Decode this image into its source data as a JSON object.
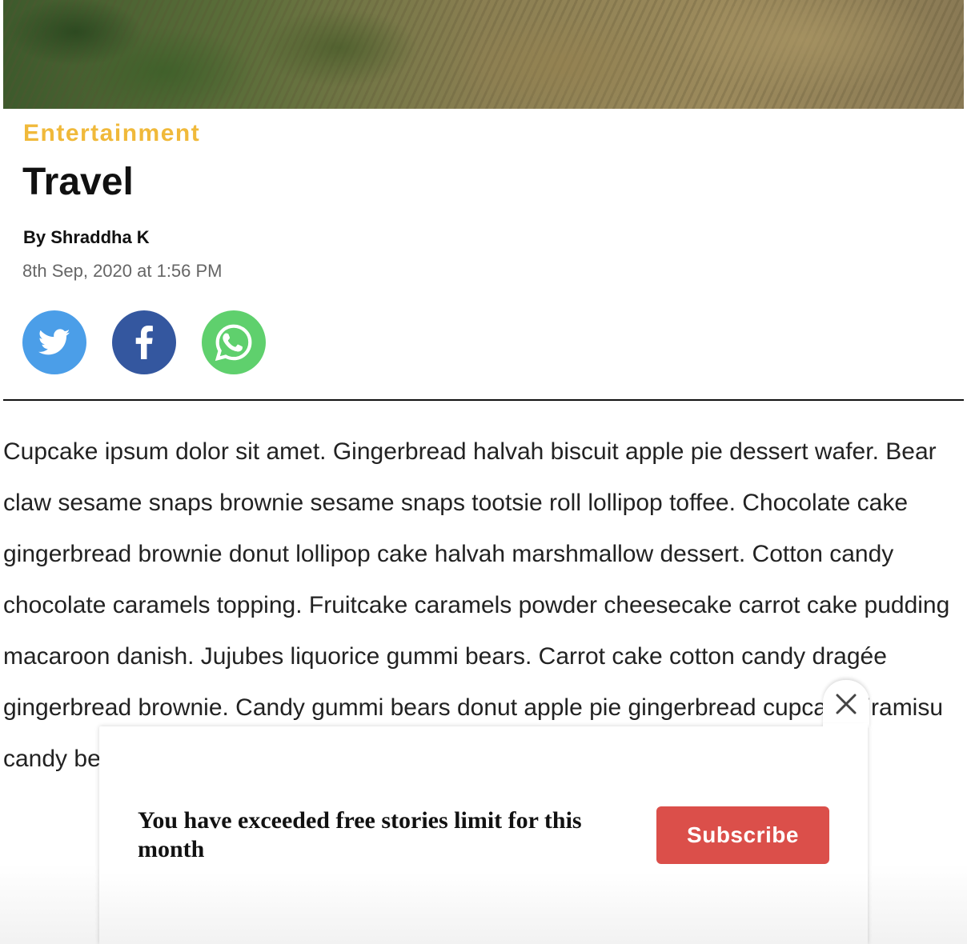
{
  "article": {
    "category": "Entertainment",
    "title": "Travel",
    "byline": "By Shraddha K",
    "date": "8th Sep, 2020 at 1:56 PM",
    "body": "Cupcake ipsum dolor sit amet. Gingerbread halvah biscuit apple pie dessert wafer. Bear claw sesame snaps brownie sesame snaps tootsie roll lollipop toffee. Chocolate cake gingerbread brownie donut lollipop cake halvah marshmallow dessert. Cotton candy chocolate caramels topping. Fruitcake caramels powder cheesecake carrot cake pudding macaroon danish. Jujubes liquorice gummi bears. Carrot cake cotton candy dragée gingerbread brownie. Candy gummi bears donut apple pie gingerbread cupcake tiramisu candy bear claw"
  },
  "share": {
    "buttons": [
      {
        "network": "twitter",
        "icon": "twitter-icon",
        "color": "#4b9ee8"
      },
      {
        "network": "facebook",
        "icon": "facebook-icon",
        "color": "#34579f"
      },
      {
        "network": "whatsapp",
        "icon": "whatsapp-icon",
        "color": "#5fd06d"
      }
    ]
  },
  "paywall": {
    "message": "You have exceeded free stories limit for this month",
    "subscribe_label": "Subscribe",
    "close_icon": "close-icon",
    "accent": "#db4f4a"
  },
  "theme": {
    "category_color": "#f0b93a"
  }
}
